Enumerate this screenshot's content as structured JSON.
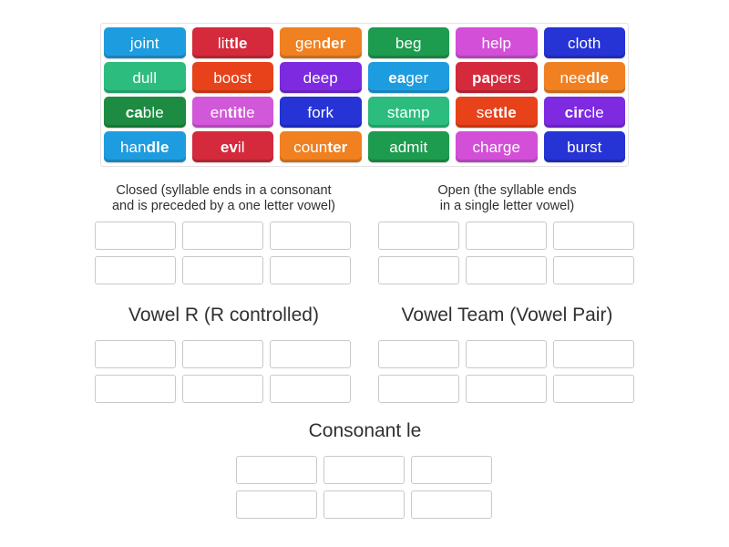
{
  "word_bank": {
    "rows": [
      [
        {
          "text": "joint",
          "plain_pre": "joint",
          "bold": "",
          "plain_post": "",
          "color": "#1e9ce0"
        },
        {
          "text": "little",
          "plain_pre": "lit",
          "bold": "tle",
          "plain_post": "",
          "color": "#d42a3c"
        },
        {
          "text": "gender",
          "plain_pre": "gen",
          "bold": "der",
          "plain_post": "",
          "color": "#f08020"
        },
        {
          "text": "beg",
          "plain_pre": "beg",
          "bold": "",
          "plain_post": "",
          "color": "#1d9b4e"
        },
        {
          "text": "help",
          "plain_pre": "help",
          "bold": "",
          "plain_post": "",
          "color": "#d34fd8"
        },
        {
          "text": "cloth",
          "plain_pre": "cloth",
          "bold": "",
          "plain_post": "",
          "color": "#2633d5"
        }
      ],
      [
        {
          "text": "dull",
          "plain_pre": "dull",
          "bold": "",
          "plain_post": "",
          "color": "#2cbd7e"
        },
        {
          "text": "boost",
          "plain_pre": "boost",
          "bold": "",
          "plain_post": "",
          "color": "#e8421a"
        },
        {
          "text": "deep",
          "plain_pre": "deep",
          "bold": "",
          "plain_post": "",
          "color": "#7d2ae0"
        },
        {
          "text": "eager",
          "plain_pre": "",
          "bold": "ea",
          "plain_post": "ger",
          "color": "#1e9ce0"
        },
        {
          "text": "papers",
          "plain_pre": "",
          "bold": "pa",
          "plain_post": "pers",
          "color": "#d42a3c"
        },
        {
          "text": "needle",
          "plain_pre": "nee",
          "bold": "dle",
          "plain_post": "",
          "color": "#f08020"
        }
      ],
      [
        {
          "text": "cable",
          "plain_pre": "",
          "bold": "ca",
          "plain_post": "ble",
          "color": "#1d8c42"
        },
        {
          "text": "entitle",
          "plain_pre": "en",
          "bold": "tit",
          "plain_post": "le",
          "color": "#d158d8"
        },
        {
          "text": "fork",
          "plain_pre": "fork",
          "bold": "",
          "plain_post": "",
          "color": "#2633d5"
        },
        {
          "text": "stamp",
          "plain_pre": "stamp",
          "bold": "",
          "plain_post": "",
          "color": "#2cbd7e"
        },
        {
          "text": "settle",
          "plain_pre": "se",
          "bold": "ttle",
          "plain_post": "",
          "color": "#e8421a"
        },
        {
          "text": "circle",
          "plain_pre": "",
          "bold": "cir",
          "plain_post": "cle",
          "color": "#7d2ae0"
        }
      ],
      [
        {
          "text": "handle",
          "plain_pre": "han",
          "bold": "dle",
          "plain_post": "",
          "color": "#1e9ce0"
        },
        {
          "text": "evil",
          "plain_pre": "",
          "bold": "ev",
          "plain_post": "il",
          "color": "#d42a3c"
        },
        {
          "text": "counter",
          "plain_pre": "coun",
          "bold": "ter",
          "plain_post": "",
          "color": "#f08020"
        },
        {
          "text": "admit",
          "plain_pre": "admit",
          "bold": "",
          "plain_post": "",
          "color": "#1d9b4e"
        },
        {
          "text": "charge",
          "plain_pre": "charge",
          "bold": "",
          "plain_post": "",
          "color": "#d34fd8"
        },
        {
          "text": "burst",
          "plain_pre": "burst",
          "bold": "",
          "plain_post": "",
          "color": "#2633d5"
        }
      ]
    ]
  },
  "categories": {
    "closed": {
      "title_line1": "Closed (syllable ends in a consonant",
      "title_line2": "and is preceded by a one letter vowel)",
      "slot_rows": 2,
      "slots_per_row": 3
    },
    "open": {
      "title_line1": "Open (the syllable ends",
      "title_line2": "in a single letter vowel)",
      "slot_rows": 2,
      "slots_per_row": 3
    },
    "vowel_r": {
      "title": "Vowel R (R controlled)",
      "slot_rows": 2,
      "slots_per_row": 3
    },
    "vowel_team": {
      "title": "Vowel Team (Vowel Pair)",
      "slot_rows": 2,
      "slots_per_row": 3
    },
    "consonant_le": {
      "title": "Consonant le",
      "slot_rows": 2,
      "slots_per_row": 3
    }
  }
}
